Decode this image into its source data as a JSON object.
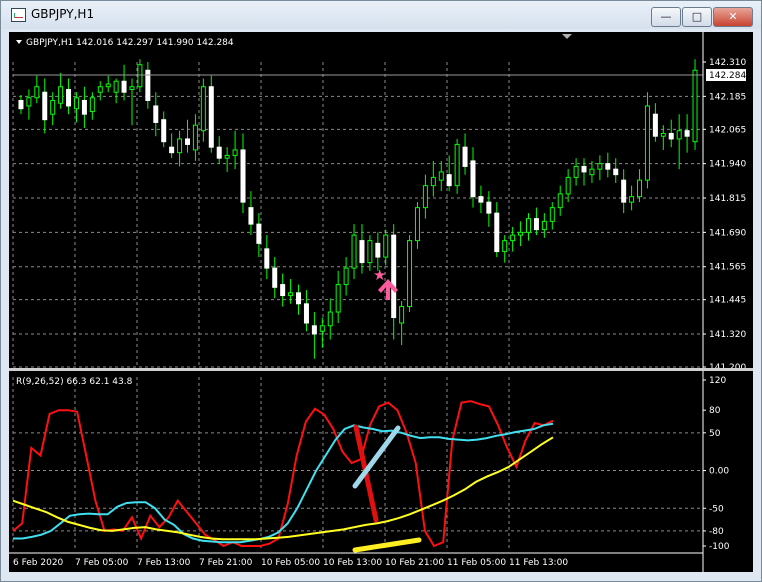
{
  "window": {
    "title": "GBPJPY,H1",
    "controls": {
      "minimize": "—",
      "maximize": "□",
      "close": "✕"
    }
  },
  "main_chart": {
    "header": "GBPJPY,H1  142.016 142.297 141.990 142.284",
    "price_ticks": [
      "142.310",
      "142.185",
      "142.065",
      "141.940",
      "141.815",
      "141.690",
      "141.565",
      "141.445",
      "141.320",
      "141.200"
    ],
    "current_price": "142.284",
    "candle_color": "#00ff00"
  },
  "indicator": {
    "header": "R(9,26,52) 66.3 62.1 43.8",
    "y_ticks": [
      "120",
      "80",
      "50",
      "0.00",
      "-50",
      "-80",
      "-100"
    ],
    "series_colors": {
      "fast": "#ff1010",
      "mid": "#40e0f0",
      "slow": "#ffff20"
    }
  },
  "time_axis": [
    "6 Feb 2020",
    "7 Feb 05:00",
    "7 Feb 13:00",
    "7 Feb 21:00",
    "10 Feb 05:00",
    "10 Feb 13:00",
    "10 Feb 21:00",
    "11 Feb 05:00",
    "11 Feb 13:00"
  ],
  "chart_data": {
    "type": "candlestick",
    "symbol": "GBPJPY",
    "timeframe": "H1",
    "ylim": [
      141.2,
      142.31
    ],
    "candles": [
      [
        142.17,
        142.19,
        142.12,
        142.14
      ],
      [
        142.15,
        142.21,
        142.1,
        142.18
      ],
      [
        142.18,
        142.26,
        142.16,
        142.22
      ],
      [
        142.2,
        142.25,
        142.05,
        142.1
      ],
      [
        142.12,
        142.2,
        142.08,
        142.17
      ],
      [
        142.16,
        142.27,
        142.14,
        142.22
      ],
      [
        142.21,
        142.25,
        142.12,
        142.15
      ],
      [
        142.14,
        142.2,
        142.09,
        142.18
      ],
      [
        142.17,
        142.22,
        142.07,
        142.12
      ],
      [
        142.13,
        142.2,
        142.1,
        142.18
      ],
      [
        142.2,
        142.24,
        142.17,
        142.22
      ],
      [
        142.22,
        142.26,
        142.2,
        142.23
      ],
      [
        142.2,
        142.25,
        142.16,
        142.24
      ],
      [
        142.24,
        142.3,
        142.17,
        142.2
      ],
      [
        142.21,
        142.25,
        142.08,
        142.22
      ],
      [
        142.22,
        142.32,
        142.2,
        142.3
      ],
      [
        142.28,
        142.31,
        142.14,
        142.17
      ],
      [
        142.15,
        142.2,
        142.04,
        142.09
      ],
      [
        142.1,
        142.13,
        142.0,
        142.02
      ],
      [
        142.0,
        142.05,
        141.96,
        141.98
      ],
      [
        141.98,
        142.06,
        141.93,
        142.03
      ],
      [
        142.03,
        142.1,
        141.98,
        142.01
      ],
      [
        141.99,
        142.12,
        141.95,
        142.08
      ],
      [
        142.06,
        142.25,
        142.02,
        142.22
      ],
      [
        142.22,
        142.26,
        141.98,
        142.0
      ],
      [
        142.0,
        142.04,
        141.94,
        141.96
      ],
      [
        141.96,
        142.0,
        141.91,
        141.97
      ],
      [
        141.97,
        142.06,
        141.92,
        141.99
      ],
      [
        141.99,
        142.05,
        141.76,
        141.8
      ],
      [
        141.78,
        141.84,
        141.68,
        141.72
      ],
      [
        141.72,
        141.76,
        141.6,
        141.65
      ],
      [
        141.63,
        141.68,
        141.52,
        141.56
      ],
      [
        141.56,
        141.6,
        141.45,
        141.49
      ],
      [
        141.5,
        141.54,
        141.42,
        141.46
      ],
      [
        141.46,
        141.52,
        141.43,
        141.47
      ],
      [
        141.47,
        141.5,
        141.39,
        141.43
      ],
      [
        141.43,
        141.48,
        141.33,
        141.36
      ],
      [
        141.35,
        141.4,
        141.23,
        141.32
      ],
      [
        141.33,
        141.38,
        141.27,
        141.35
      ],
      [
        141.35,
        141.45,
        141.3,
        141.4
      ],
      [
        141.4,
        141.55,
        141.36,
        141.5
      ],
      [
        141.5,
        141.6,
        141.46,
        141.56
      ],
      [
        141.56,
        141.72,
        141.52,
        141.68
      ],
      [
        141.66,
        141.72,
        141.54,
        141.58
      ],
      [
        141.58,
        141.68,
        141.55,
        141.66
      ],
      [
        141.65,
        141.69,
        141.55,
        141.6
      ],
      [
        141.6,
        141.7,
        141.57,
        141.68
      ],
      [
        141.68,
        141.72,
        141.3,
        141.38
      ],
      [
        141.36,
        141.44,
        141.28,
        141.42
      ],
      [
        141.42,
        141.68,
        141.4,
        141.66
      ],
      [
        141.66,
        141.8,
        141.63,
        141.78
      ],
      [
        141.78,
        141.9,
        141.74,
        141.86
      ],
      [
        141.86,
        141.95,
        141.82,
        141.89
      ],
      [
        141.88,
        141.95,
        141.84,
        141.91
      ],
      [
        141.9,
        141.97,
        141.84,
        141.86
      ],
      [
        141.86,
        142.03,
        141.83,
        142.01
      ],
      [
        142.0,
        142.05,
        141.9,
        141.93
      ],
      [
        141.95,
        142.0,
        141.78,
        141.82
      ],
      [
        141.82,
        141.86,
        141.76,
        141.8
      ],
      [
        141.8,
        141.84,
        141.71,
        141.76
      ],
      [
        141.76,
        141.8,
        141.6,
        141.62
      ],
      [
        141.62,
        141.68,
        141.58,
        141.66
      ],
      [
        141.66,
        141.71,
        141.62,
        141.68
      ],
      [
        141.68,
        141.73,
        141.64,
        141.69
      ],
      [
        141.69,
        141.76,
        141.66,
        141.74
      ],
      [
        141.74,
        141.78,
        141.68,
        141.7
      ],
      [
        141.7,
        141.76,
        141.67,
        141.73
      ],
      [
        141.73,
        141.8,
        141.7,
        141.78
      ],
      [
        141.78,
        141.86,
        141.75,
        141.83
      ],
      [
        141.83,
        141.92,
        141.8,
        141.89
      ],
      [
        141.89,
        141.96,
        141.86,
        141.93
      ],
      [
        141.93,
        141.96,
        141.86,
        141.91
      ],
      [
        141.9,
        141.95,
        141.87,
        141.92
      ],
      [
        141.92,
        141.97,
        141.88,
        141.94
      ],
      [
        141.94,
        141.98,
        141.89,
        141.92
      ],
      [
        141.92,
        141.96,
        141.87,
        141.9
      ],
      [
        141.88,
        141.92,
        141.76,
        141.8
      ],
      [
        141.8,
        141.86,
        141.77,
        141.82
      ],
      [
        141.82,
        141.92,
        141.8,
        141.88
      ],
      [
        141.88,
        142.2,
        141.85,
        142.15
      ],
      [
        142.12,
        142.16,
        142.02,
        142.04
      ],
      [
        142.04,
        142.08,
        141.99,
        142.05
      ],
      [
        142.05,
        142.1,
        142.0,
        142.03
      ],
      [
        142.03,
        142.12,
        141.92,
        142.06
      ],
      [
        142.06,
        142.12,
        141.98,
        142.04
      ],
      [
        142.02,
        142.32,
        141.99,
        142.28
      ]
    ],
    "indicator": {
      "name": "R(9,26,52)",
      "ylim": [
        -100,
        120
      ],
      "hlines": [
        50,
        0,
        -50,
        -80
      ],
      "series": [
        {
          "name": "fast",
          "values": [
            -80,
            -70,
            30,
            20,
            75,
            80,
            80,
            78,
            20,
            -40,
            -80,
            -78,
            -80,
            -62,
            -90,
            -60,
            -75,
            -62,
            -40,
            -55,
            -70,
            -85,
            -92,
            -100,
            -95,
            -100,
            -100,
            -100,
            -97,
            -90,
            -45,
            20,
            65,
            82,
            74,
            55,
            25,
            10,
            15,
            60,
            85,
            90,
            80,
            50,
            10,
            -80,
            -100,
            -95,
            40,
            90,
            92,
            88,
            85,
            60,
            30,
            5,
            40,
            63,
            60,
            66
          ]
        },
        {
          "name": "mid",
          "values": [
            -90,
            -90,
            -88,
            -85,
            -80,
            -70,
            -60,
            -58,
            -57,
            -58,
            -58,
            -48,
            -43,
            -42,
            -42,
            -50,
            -65,
            -72,
            -84,
            -90,
            -93,
            -94,
            -95,
            -95,
            -95,
            -93,
            -91,
            -88,
            -82,
            -70,
            -50,
            -25,
            0,
            20,
            40,
            55,
            60,
            57,
            55,
            52,
            53,
            50,
            46,
            43,
            44,
            44,
            42,
            41,
            40,
            41,
            43,
            46,
            48,
            51,
            53,
            55,
            60,
            62
          ]
        },
        {
          "name": "slow",
          "values": [
            -40,
            -45,
            -50,
            -55,
            -62,
            -68,
            -72,
            -76,
            -79,
            -80,
            -78,
            -76,
            -75,
            -78,
            -80,
            -82,
            -85,
            -88,
            -90,
            -91,
            -91,
            -91,
            -91,
            -90,
            -89,
            -88,
            -86,
            -84,
            -82,
            -80,
            -78,
            -75,
            -72,
            -70,
            -67,
            -63,
            -58,
            -52,
            -46,
            -40,
            -33,
            -25,
            -15,
            -8,
            -2,
            5,
            15,
            25,
            35,
            44
          ]
        }
      ]
    }
  }
}
